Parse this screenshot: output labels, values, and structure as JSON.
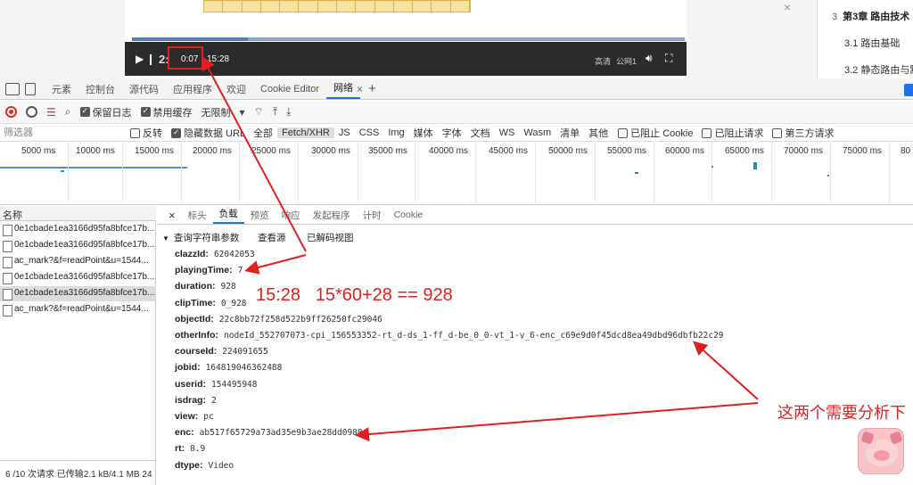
{
  "toc": {
    "chapter_num": "3",
    "chapter_title": "第3章 路由技术",
    "sec1": "3.1 路由基础",
    "sec2": "3.2 静态路由与默"
  },
  "player": {
    "time_faint": "2:",
    "current_time": "0:07",
    "duration": "15:28",
    "quality": "高清",
    "line": "公网1",
    "progress_fraction": 0.21
  },
  "devtools": {
    "tabs": [
      "元素",
      "控制台",
      "源代码",
      "应用程序",
      "欢迎",
      "Cookie Editor",
      "网络"
    ],
    "active_tab": "网络",
    "toolbar": {
      "preserve_log": "保留日志",
      "disable_cache": "禁用缓存",
      "throttling": "无限制"
    },
    "filter": {
      "placeholder": "筛选器",
      "invert": "反转",
      "hide_data_urls": "隐藏数据 URL",
      "types": [
        "全部",
        "Fetch/XHR",
        "JS",
        "CSS",
        "Img",
        "媒体",
        "字体",
        "文档",
        "WS",
        "Wasm",
        "清单",
        "其他"
      ],
      "selected_type": "Fetch/XHR",
      "blocked_cookies": "已阻止 Cookie",
      "blocked_requests": "已阻止请求",
      "third_party": "第三方请求"
    },
    "timeline_ticks": [
      "5000 ms",
      "10000 ms",
      "15000 ms",
      "20000 ms",
      "25000 ms",
      "30000 ms",
      "35000 ms",
      "40000 ms",
      "45000 ms",
      "50000 ms",
      "55000 ms",
      "60000 ms",
      "65000 ms",
      "70000 ms",
      "75000 ms",
      "80"
    ],
    "requests": {
      "header": "名称",
      "rows": [
        "0e1cbade1ea3166d95fa8bfce17b...",
        "0e1cbade1ea3166d95fa8bfce17b...",
        "ac_mark?&f=readPoint&u=1544...",
        "0e1cbade1ea3166d95fa8bfce17b...",
        "0e1cbade1ea3166d95fa8bfce17b...",
        "ac_mark?&f=readPoint&u=1544..."
      ],
      "selected_index": 4
    },
    "status": "6 /10 次请求  已传输2.1 kB/4.1 MB  24",
    "detail_tabs": [
      "标头",
      "负载",
      "预览",
      "响应",
      "发起程序",
      "计时",
      "Cookie"
    ],
    "active_detail_tab": "负载",
    "payload": {
      "section": "查询字符串参数",
      "view_source": "查看源",
      "view_decoded": "已解码视图",
      "params": [
        {
          "key": "clazzId:",
          "value": "62042053"
        },
        {
          "key": "playingTime:",
          "value": "7"
        },
        {
          "key": "duration:",
          "value": "928"
        },
        {
          "key": "clipTime:",
          "value": "0_928"
        },
        {
          "key": "objectId:",
          "value": "22c8bb72f258d522b9ff26250fc29046"
        },
        {
          "key": "otherInfo:",
          "value": "nodeId_552707073-cpi_156553352-rt_d-ds_1-ff_d-be_0_0-vt_1-v_6-enc_c69e9d0f45dcd8ea49dbd96dbfb22c29"
        },
        {
          "key": "courseId:",
          "value": "224091655"
        },
        {
          "key": "jobid:",
          "value": "164819046362488"
        },
        {
          "key": "userid:",
          "value": "154495948"
        },
        {
          "key": "isdrag:",
          "value": "2"
        },
        {
          "key": "view:",
          "value": "pc"
        },
        {
          "key": "enc:",
          "value": "ab517f65729a73ad35e9b3ae28dd0988"
        },
        {
          "key": "rt:",
          "value": "0.9"
        },
        {
          "key": "dtype:",
          "value": "Video"
        }
      ]
    }
  },
  "annotations": {
    "formula": "15:28   15*60+28 == 928",
    "note": "这两个需要分析下",
    "color": "#e02020"
  }
}
